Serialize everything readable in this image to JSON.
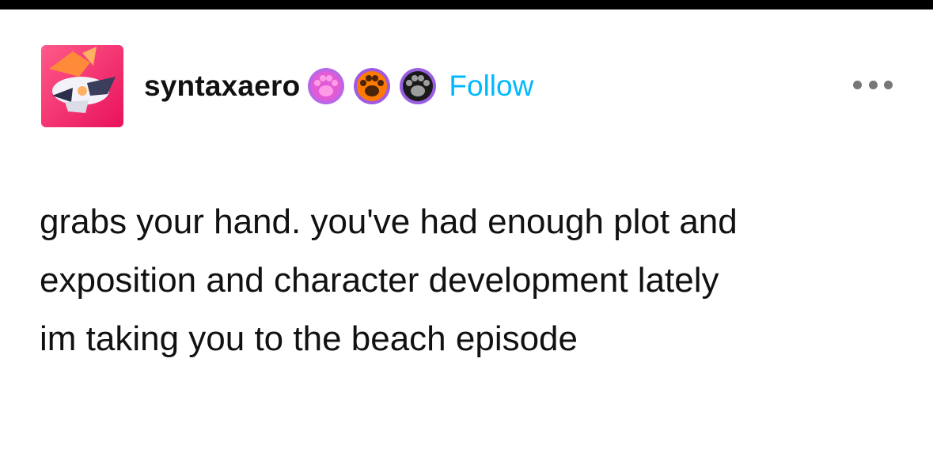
{
  "post": {
    "username": "syntaxaero",
    "follow_label": "Follow",
    "badges": [
      {
        "icon": "paw-icon",
        "ring": "#b867e6",
        "fill": "#e15bd6",
        "pad": "#ff9be6"
      },
      {
        "icon": "paw-icon",
        "ring": "#a05ae0",
        "fill": "#ff7a00",
        "pad": "#4a2308"
      },
      {
        "icon": "paw-icon",
        "ring": "#9a5ee0",
        "fill": "#1a1a1a",
        "pad": "#9e9e9e"
      }
    ],
    "body_lines": [
      "grabs your hand. you've had enough plot and",
      "exposition and character development lately",
      "im taking you to the beach episode"
    ]
  },
  "colors": {
    "follow": "#00b8ff",
    "text": "#111111",
    "avatar_bg": "#f4246a"
  }
}
